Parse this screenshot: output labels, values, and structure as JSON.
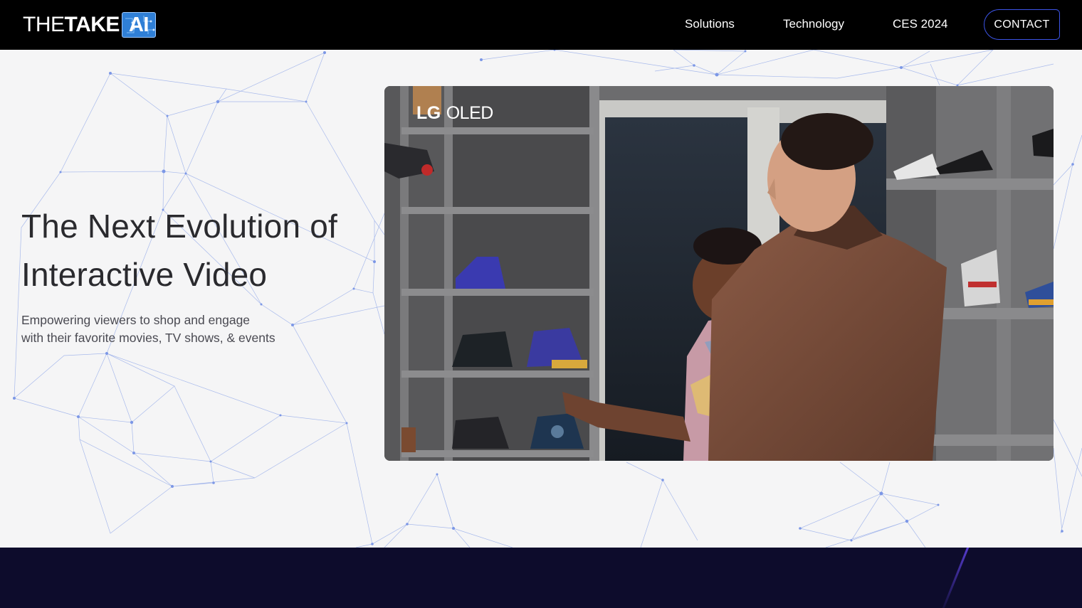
{
  "header": {
    "logo": {
      "the": "THE",
      "take": "TAKE",
      "ai": "AI"
    },
    "nav": [
      {
        "label": "Solutions"
      },
      {
        "label": "Technology"
      },
      {
        "label": "CES 2024"
      }
    ],
    "contact_label": "CONTACT"
  },
  "hero": {
    "title_line1": "The Next Evolution of",
    "title_line2": "Interactive Video",
    "subtitle_line1": "Empowering viewers to shop and engage",
    "subtitle_line2": "with their favorite movies, TV shows, & events"
  },
  "video": {
    "brand_lg": "LG",
    "brand_oled": "OLED"
  },
  "colors": {
    "header_bg": "#000000",
    "accent": "#3c54e6",
    "page_bg": "#f5f5f6",
    "network_lines": "#8ea6e8",
    "bottom_band": "#0d0c2c"
  }
}
